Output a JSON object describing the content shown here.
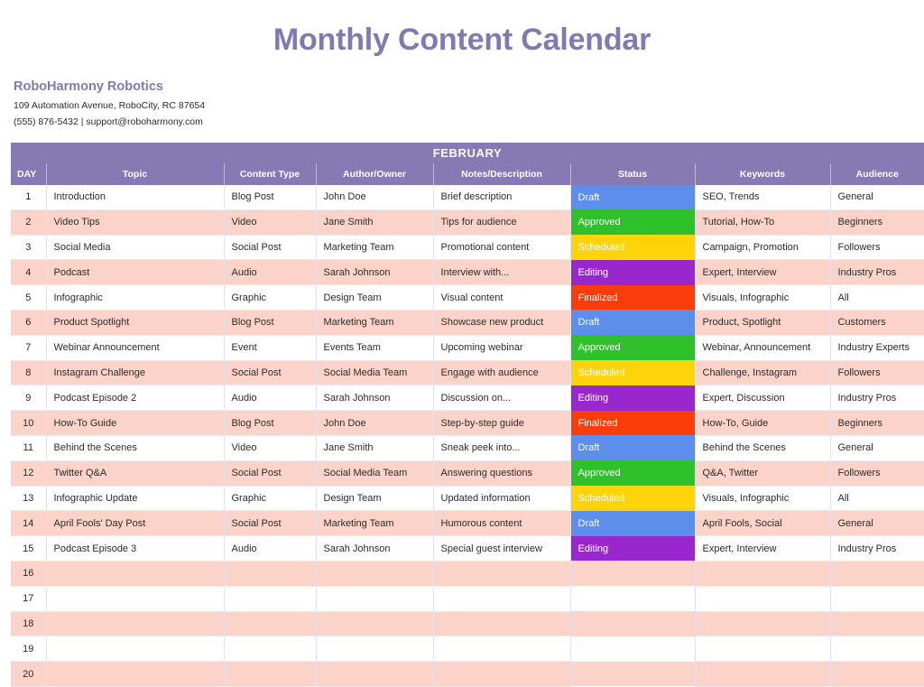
{
  "page": {
    "title": "Monthly Content Calendar",
    "title_color": "#8279b3"
  },
  "company": {
    "name": "RoboHarmony Robotics",
    "address": "109 Automation Avenue, RoboCity, RC 87654",
    "contact": "(555) 876-5432 | support@roboharmony.com"
  },
  "calendar": {
    "month": "FEBRUARY",
    "header_color": "#8779b4",
    "zebra_color": "#fbd3c9",
    "columns": [
      "DAY",
      "Topic",
      "Content Type",
      "Author/Owner",
      "Notes/Description",
      "Status",
      "Keywords",
      "Audience"
    ],
    "status_colors": {
      "Draft": "#5e8eeb",
      "Approved": "#2ec12b",
      "Scheduled": "#fdd40a",
      "Editing": "#9a27ce",
      "Finalized": "#fb3c0b"
    },
    "rows": [
      {
        "day": "1",
        "topic": "Introduction",
        "content_type": "Blog Post",
        "author": "John Doe",
        "notes": "Brief description",
        "status": "Draft",
        "keywords": "SEO, Trends",
        "audience": "General"
      },
      {
        "day": "2",
        "topic": "Video Tips",
        "content_type": "Video",
        "author": "Jane Smith",
        "notes": "Tips for audience",
        "status": "Approved",
        "keywords": "Tutorial, How-To",
        "audience": "Beginners"
      },
      {
        "day": "3",
        "topic": "Social Media",
        "content_type": "Social Post",
        "author": "Marketing Team",
        "notes": "Promotional content",
        "status": "Scheduled",
        "keywords": "Campaign, Promotion",
        "audience": "Followers"
      },
      {
        "day": "4",
        "topic": "Podcast",
        "content_type": "Audio",
        "author": "Sarah Johnson",
        "notes": "Interview with...",
        "status": "Editing",
        "keywords": "Expert, Interview",
        "audience": "Industry Pros"
      },
      {
        "day": "5",
        "topic": "Infographic",
        "content_type": "Graphic",
        "author": "Design Team",
        "notes": "Visual content",
        "status": "Finalized",
        "keywords": "Visuals, Infographic",
        "audience": "All"
      },
      {
        "day": "6",
        "topic": "Product Spotlight",
        "content_type": "Blog Post",
        "author": "Marketing Team",
        "notes": "Showcase new product",
        "status": "Draft",
        "keywords": "Product, Spotlight",
        "audience": "Customers"
      },
      {
        "day": "7",
        "topic": "Webinar Announcement",
        "content_type": "Event",
        "author": "Events Team",
        "notes": "Upcoming webinar",
        "status": "Approved",
        "keywords": "Webinar, Announcement",
        "audience": "Industry Experts"
      },
      {
        "day": "8",
        "topic": "Instagram Challenge",
        "content_type": "Social Post",
        "author": "Social Media Team",
        "notes": "Engage with audience",
        "status": "Scheduled",
        "keywords": "Challenge, Instagram",
        "audience": "Followers"
      },
      {
        "day": "9",
        "topic": "Podcast Episode 2",
        "content_type": "Audio",
        "author": "Sarah Johnson",
        "notes": "Discussion on...",
        "status": "Editing",
        "keywords": "Expert, Discussion",
        "audience": "Industry Pros"
      },
      {
        "day": "10",
        "topic": "How-To Guide",
        "content_type": "Blog Post",
        "author": "John Doe",
        "notes": "Step-by-step guide",
        "status": "Finalized",
        "keywords": "How-To, Guide",
        "audience": "Beginners"
      },
      {
        "day": "11",
        "topic": "Behind the Scenes",
        "content_type": "Video",
        "author": "Jane Smith",
        "notes": "Sneak peek into...",
        "status": "Draft",
        "keywords": "Behind the Scenes",
        "audience": "General"
      },
      {
        "day": "12",
        "topic": "Twitter Q&A",
        "content_type": "Social Post",
        "author": "Social Media Team",
        "notes": "Answering questions",
        "status": "Approved",
        "keywords": "Q&A, Twitter",
        "audience": "Followers"
      },
      {
        "day": "13",
        "topic": "Infographic Update",
        "content_type": "Graphic",
        "author": "Design Team",
        "notes": "Updated information",
        "status": "Scheduled",
        "keywords": "Visuals, Infographic",
        "audience": "All"
      },
      {
        "day": "14",
        "topic": "April Fools' Day Post",
        "content_type": "Social Post",
        "author": "Marketing Team",
        "notes": "Humorous content",
        "status": "Draft",
        "keywords": "April Fools, Social",
        "audience": "General"
      },
      {
        "day": "15",
        "topic": "Podcast Episode 3",
        "content_type": "Audio",
        "author": "Sarah Johnson",
        "notes": "Special guest interview",
        "status": "Editing",
        "keywords": "Expert, Interview",
        "audience": "Industry Pros"
      },
      {
        "day": "16",
        "topic": "",
        "content_type": "",
        "author": "",
        "notes": "",
        "status": "",
        "keywords": "",
        "audience": ""
      },
      {
        "day": "17",
        "topic": "",
        "content_type": "",
        "author": "",
        "notes": "",
        "status": "",
        "keywords": "",
        "audience": ""
      },
      {
        "day": "18",
        "topic": "",
        "content_type": "",
        "author": "",
        "notes": "",
        "status": "",
        "keywords": "",
        "audience": ""
      },
      {
        "day": "19",
        "topic": "",
        "content_type": "",
        "author": "",
        "notes": "",
        "status": "",
        "keywords": "",
        "audience": ""
      },
      {
        "day": "20",
        "topic": "",
        "content_type": "",
        "author": "",
        "notes": "",
        "status": "",
        "keywords": "",
        "audience": ""
      }
    ]
  }
}
